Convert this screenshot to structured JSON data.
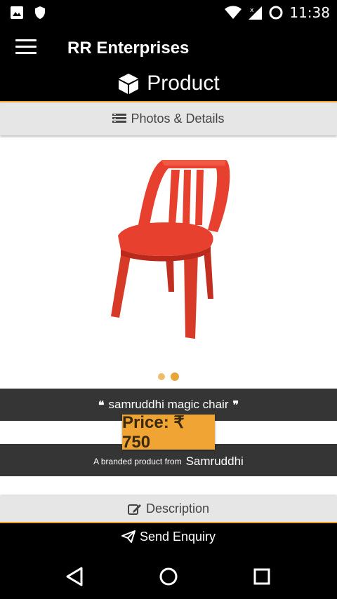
{
  "status_bar": {
    "time": "11:38",
    "left_icons": [
      "image-icon",
      "shield-icon"
    ],
    "right_icons": [
      "wifi-icon",
      "signal-icon",
      "data-saver-icon"
    ]
  },
  "app_bar": {
    "title": "RR Enterprises",
    "menu_icon": "hamburger-menu-icon"
  },
  "page_header": {
    "title": "Product",
    "icon": "cube-icon"
  },
  "photos_tab": {
    "label": "Photos & Details",
    "icon": "list-icon"
  },
  "carousel": {
    "image_alt": "red plastic chair",
    "dots": 2,
    "active_dot": 2
  },
  "product": {
    "name": "samruddhi magic chair",
    "price_label": "Price: ₹ 750",
    "brand_prefix": "A branded product from",
    "brand_name": "Samruddhi"
  },
  "description_tab": {
    "label": "Description",
    "icon": "edit-icon"
  },
  "enquiry": {
    "label": "Send Enquiry",
    "icon": "paper-plane-icon"
  },
  "nav_bar": {
    "buttons": [
      "back-icon",
      "home-icon",
      "recents-icon"
    ]
  },
  "colors": {
    "accent": "#f0a12f",
    "dark_bar": "#353535",
    "light_bar": "#e6e6e6",
    "chair": "#e8402e"
  }
}
